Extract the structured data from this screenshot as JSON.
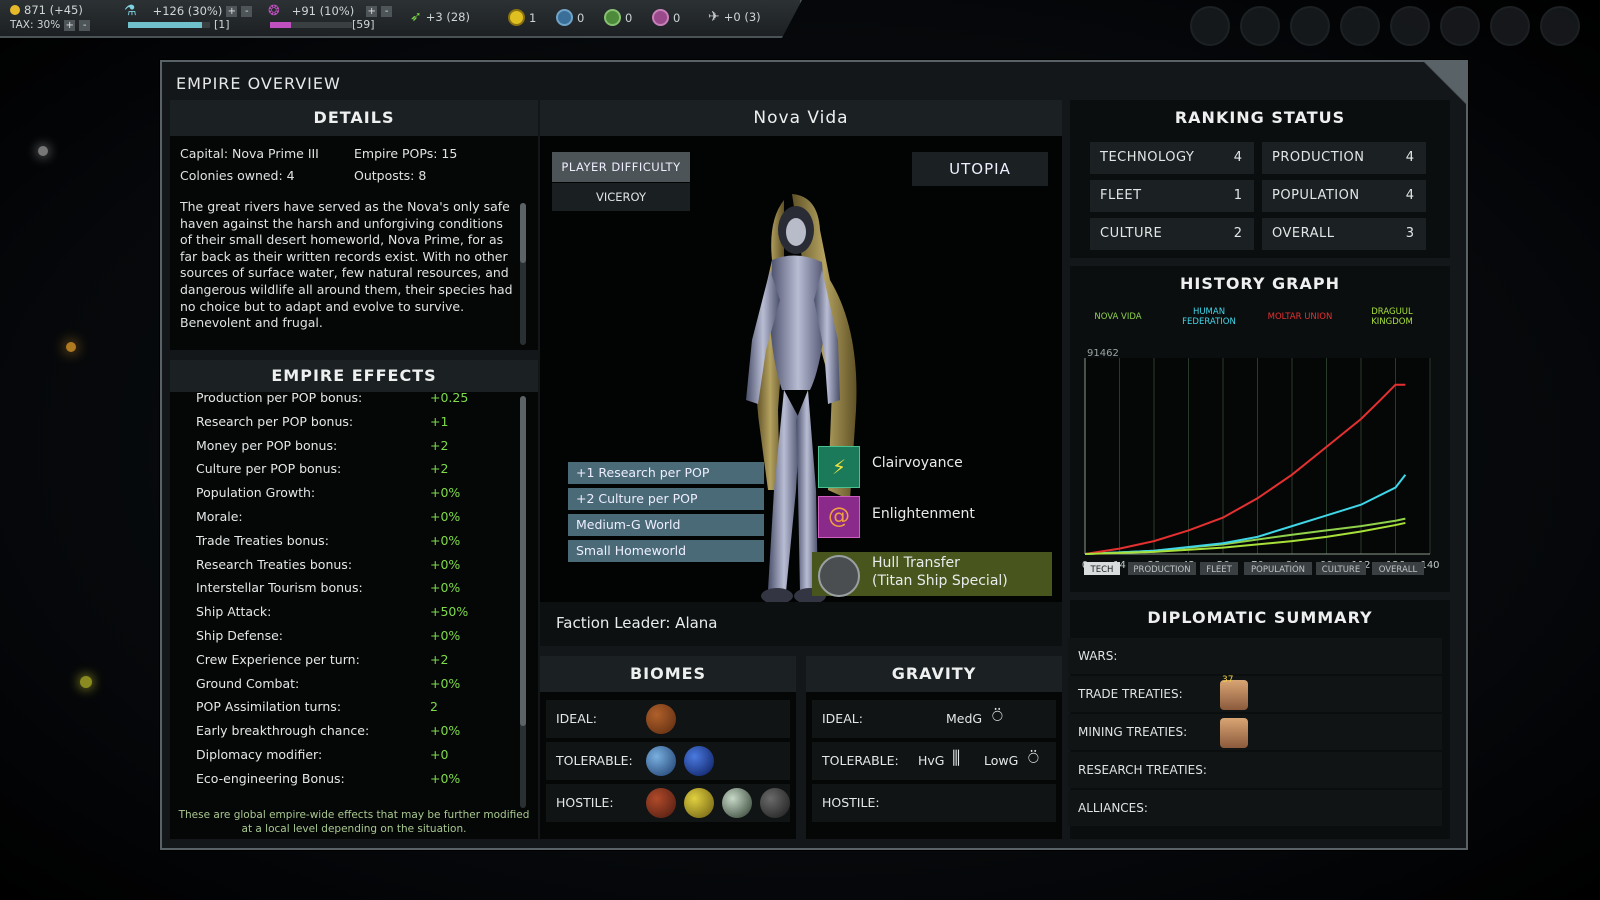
{
  "topbar": {
    "money": "871 (+45)",
    "tax": "TAX: 30%",
    "research": "+126 (30%)",
    "research_sub": "[1]",
    "culture": "+91 (10%)",
    "culture_sub": "[59]",
    "ships": "+3 (28)",
    "res1": "1",
    "res2": "0",
    "res3": "0",
    "res4": "0",
    "influence": "+0 (3)",
    "research_progress": 0.9,
    "culture_progress": 0.25
  },
  "panel_title": "EMPIRE OVERVIEW",
  "details": {
    "title": "DETAILS",
    "capital": "Capital: Nova Prime III",
    "pops": "Empire POPs: 15",
    "colonies": "Colonies owned: 4",
    "outposts": "Outposts: 8",
    "lore": "The great rivers have served as the Nova's only safe haven against the harsh and unforgiving conditions of their small desert homeworld, Nova Prime, for as far back as their written records exist. With no other sources of surface water, few natural resources, and dangerous wildlife all around them, their species had no choice but to adapt and evolve to survive. Benevolent and frugal."
  },
  "effects": {
    "title": "EMPIRE EFFECTS",
    "rows": [
      {
        "label": "Production per POP bonus:",
        "value": "+0.25"
      },
      {
        "label": "Research per POP bonus:",
        "value": "+1"
      },
      {
        "label": "Money per POP bonus:",
        "value": "+2"
      },
      {
        "label": "Culture per POP bonus:",
        "value": "+2"
      },
      {
        "label": "Population Growth:",
        "value": "+0%"
      },
      {
        "label": "Morale:",
        "value": "+0%"
      },
      {
        "label": "Trade Treaties bonus:",
        "value": "+0%"
      },
      {
        "label": "Research Treaties bonus:",
        "value": "+0%"
      },
      {
        "label": "Interstellar Tourism bonus:",
        "value": "+0%"
      },
      {
        "label": "Ship Attack:",
        "value": "+50%"
      },
      {
        "label": "Ship Defense:",
        "value": "+0%"
      },
      {
        "label": "Crew Experience per turn:",
        "value": "+2"
      },
      {
        "label": "Ground Combat:",
        "value": "+0%"
      },
      {
        "label": "POP Assimilation turns:",
        "value": "2"
      },
      {
        "label": "Early breakthrough chance:",
        "value": "+0%"
      },
      {
        "label": "Diplomacy modifier:",
        "value": "+0"
      },
      {
        "label": "Eco-engineering Bonus:",
        "value": "+0%"
      }
    ],
    "footnote": "These are global empire-wide effects that may be further modified at a local level depending on the situation."
  },
  "faction": {
    "name": "Nova Vida",
    "difficulty_label": "PLAYER DIFFICULTY",
    "difficulty_value": "VICEROY",
    "government": "UTOPIA",
    "traits": [
      "+1 Research per POP",
      "+2 Culture per POP",
      "Medium-G World",
      "Small Homeworld"
    ],
    "abilities": [
      {
        "name": "Clairvoyance",
        "icon": "clairvoyance-icon"
      },
      {
        "name": "Enlightenment",
        "icon": "enlightenment-icon"
      },
      {
        "name": "Hull Transfer",
        "sub": "(Titan Ship Special)",
        "icon": "hull-transfer-icon"
      }
    ],
    "leader": "Faction Leader: Alana"
  },
  "biomes": {
    "title": "BIOMES",
    "ideal": "IDEAL:",
    "tolerable": "TOLERABLE:",
    "hostile": "HOSTILE:"
  },
  "gravity": {
    "title": "GRAVITY",
    "ideal": "IDEAL:",
    "ideal_value": "MedG",
    "tolerable": "TOLERABLE:",
    "tol_high": "HvG",
    "tol_low": "LowG",
    "hostile": "HOSTILE:"
  },
  "ranking": {
    "title": "RANKING STATUS",
    "items": [
      {
        "label": "TECHNOLOGY",
        "value": "4"
      },
      {
        "label": "PRODUCTION",
        "value": "4"
      },
      {
        "label": "FLEET",
        "value": "1"
      },
      {
        "label": "POPULATION",
        "value": "4"
      },
      {
        "label": "CULTURE",
        "value": "2"
      },
      {
        "label": "OVERALL",
        "value": "3"
      }
    ]
  },
  "history": {
    "title": "HISTORY GRAPH",
    "buttons": [
      "TECH",
      "PRODUCTION",
      "FLEET",
      "POPULATION",
      "CULTURE",
      "OVERALL"
    ]
  },
  "chart_data": {
    "type": "line",
    "ymax_label": "91462",
    "x": [
      0,
      14,
      28,
      42,
      56,
      70,
      84,
      98,
      112,
      126,
      140
    ],
    "xlim": [
      0,
      140
    ],
    "ylim": [
      0,
      91462
    ],
    "series": [
      {
        "name": "NOVA VIDA",
        "color": "#8fd14a",
        "x": [
          0,
          28,
          56,
          84,
          98,
          112,
          126,
          130
        ],
        "y": [
          0,
          1500,
          4500,
          9000,
          11000,
          13000,
          15500,
          16500
        ]
      },
      {
        "name": "HUMAN FEDERATION",
        "color": "#3fd6e8",
        "x": [
          0,
          28,
          56,
          70,
          84,
          98,
          112,
          126,
          130
        ],
        "y": [
          0,
          1500,
          5000,
          8000,
          13000,
          18000,
          23000,
          31000,
          37000
        ]
      },
      {
        "name": "MOLTAR UNION",
        "color": "#e53030",
        "x": [
          0,
          14,
          28,
          42,
          56,
          70,
          84,
          98,
          112,
          120,
          126,
          130
        ],
        "y": [
          0,
          2500,
          6000,
          11000,
          17000,
          26000,
          37000,
          50000,
          63000,
          72000,
          79000,
          79000
        ]
      },
      {
        "name": "DRAGUUL KINGDOM",
        "color": "#a8e03a",
        "x": [
          0,
          28,
          56,
          84,
          98,
          112,
          126,
          130
        ],
        "y": [
          0,
          1000,
          3000,
          6000,
          8000,
          10500,
          13500,
          14500
        ]
      }
    ]
  },
  "diplomacy": {
    "title": "DIPLOMATIC SUMMARY",
    "wars": "WARS:",
    "trade": "TRADE TREATIES:",
    "trade_badge": "37",
    "mining": "MINING TREATIES:",
    "research": "RESEARCH TREATIES:",
    "alliances": "ALLIANCES:"
  }
}
